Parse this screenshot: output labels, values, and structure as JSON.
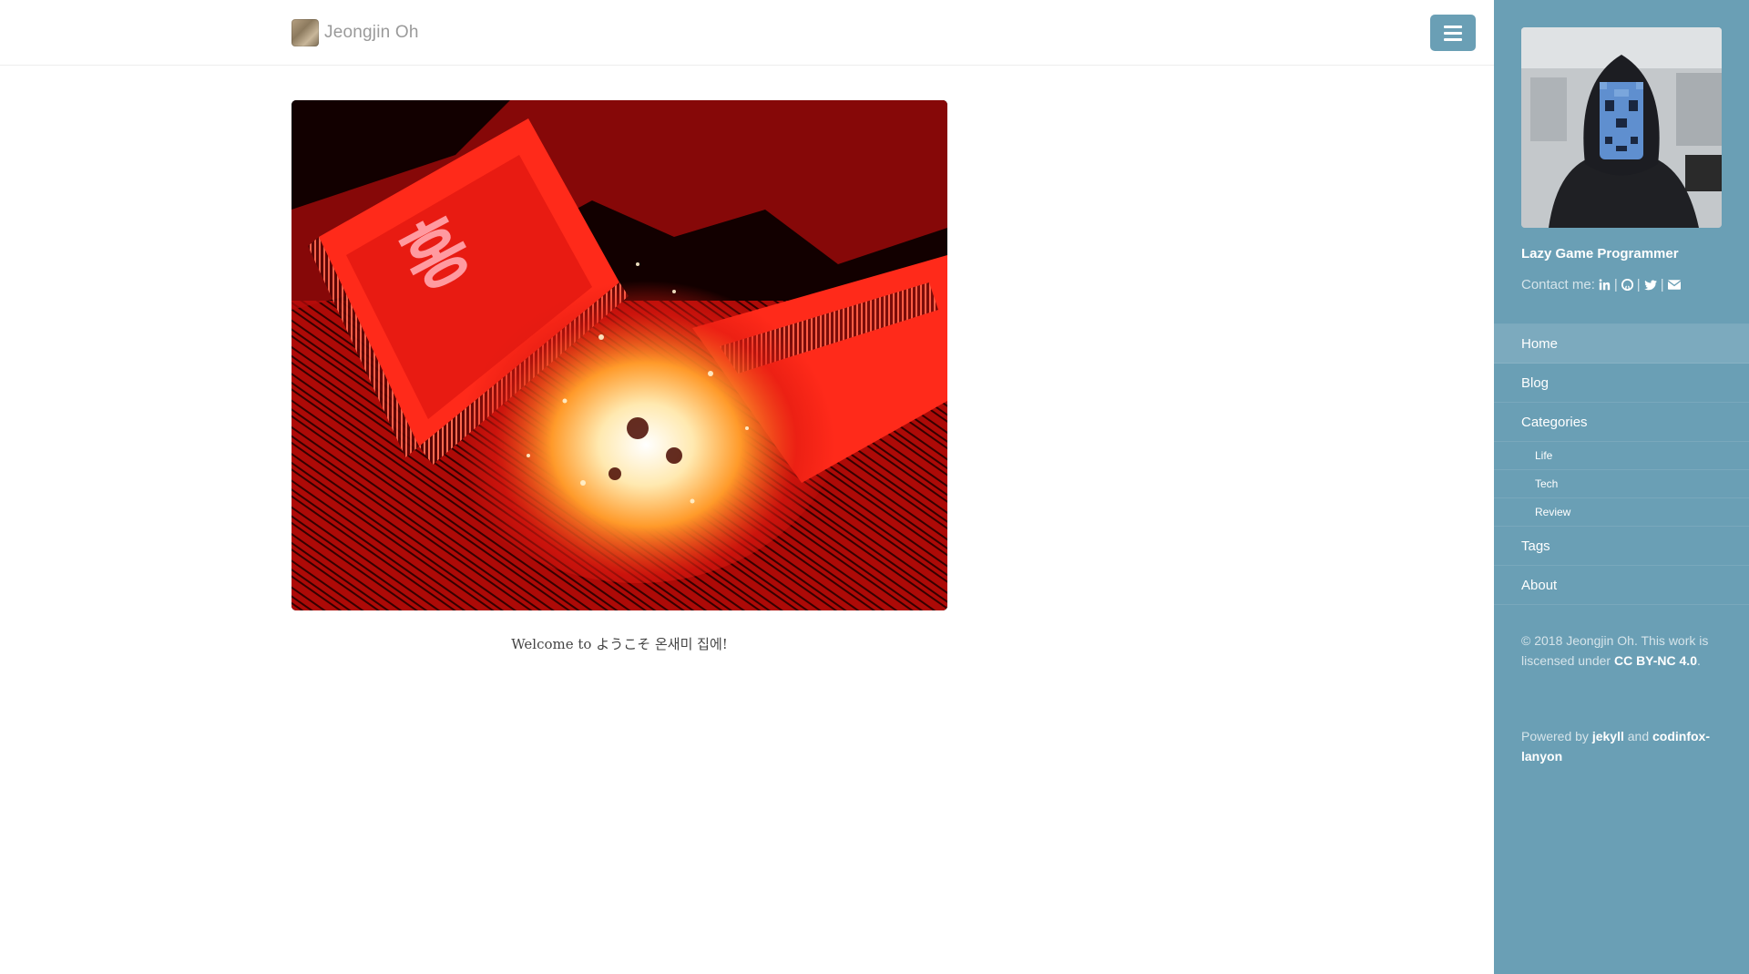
{
  "masthead": {
    "brand_title": "Jeongjin Oh",
    "brand_logo_icon": "site-logo-icon",
    "menu_icon": "hamburger-menu-icon"
  },
  "main": {
    "welcome_text": "Welcome to ようこそ 온새미 집에!"
  },
  "sidebar": {
    "profile_title": "Lazy Game Programmer",
    "contact_label": "Contact me:",
    "contact_icons": [
      "linkedin-icon",
      "github-icon",
      "twitter-icon",
      "email-icon"
    ],
    "nav": {
      "home": "Home",
      "blog": "Blog",
      "categories": "Categories",
      "life": "Life",
      "tech": "Tech",
      "review": "Review",
      "tags": "Tags",
      "about": "About"
    },
    "copyright": {
      "prefix": "© 2018 Jeongjin Oh. This work is liscensed under ",
      "license_link": "CC BY-NC 4.0",
      "suffix": "."
    },
    "powered": {
      "prefix": "Powered by ",
      "jekyll_link": "jekyll",
      "middle": " and ",
      "theme_link": "codinfox-lanyon"
    }
  },
  "colors": {
    "sidebar_bg": "#6a9fb5",
    "menu_button": "#6a9fb5",
    "hero_red": "#e01010"
  }
}
